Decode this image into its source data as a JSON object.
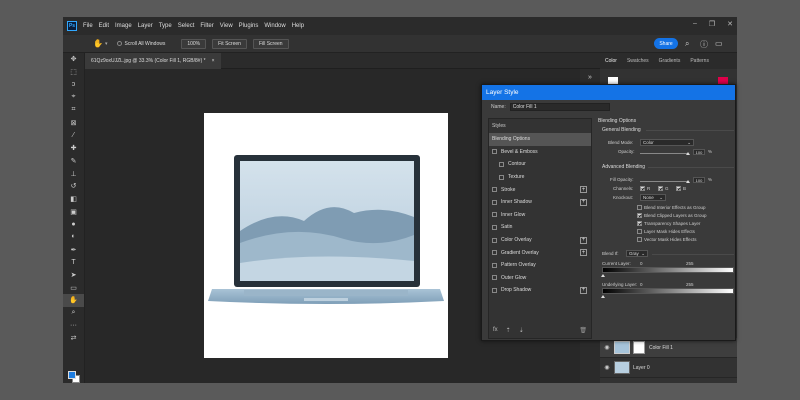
{
  "menubar": {
    "logo": "Ps",
    "items": [
      "File",
      "Edit",
      "Image",
      "Layer",
      "Type",
      "Select",
      "Filter",
      "View",
      "Plugins",
      "Window",
      "Help"
    ]
  },
  "options": {
    "scroll_all": "Scroll All Windows",
    "zoom100": "100%",
    "fit_screen": "Fit Screen",
    "fill_screen": "Fill Screen",
    "share": "Share"
  },
  "document": {
    "tab_title": "61Qz9oxUJZL.jpg @ 33.3% (Color Fill 1, RGB/8#) *",
    "close": "×"
  },
  "panel": {
    "tabs": [
      "Color",
      "Swatches",
      "Gradients",
      "Patterns"
    ],
    "fg_color": "#ffffff",
    "accent_color": "#e0004a"
  },
  "layers": [
    {
      "name": "Color Fill 1",
      "selected": true
    },
    {
      "name": "Layer 0",
      "selected": false
    }
  ],
  "dialog": {
    "title": "Layer Style",
    "name_label": "Name:",
    "name_value": "Color Fill 1",
    "styles_header": "Styles",
    "items": [
      {
        "label": "Blending Options",
        "check": false,
        "plus": false,
        "sub": false,
        "selected": true
      },
      {
        "label": "Bevel & Emboss",
        "check": true,
        "plus": false,
        "sub": false
      },
      {
        "label": "Contour",
        "check": true,
        "plus": false,
        "sub": true
      },
      {
        "label": "Texture",
        "check": true,
        "plus": false,
        "sub": true
      },
      {
        "label": "Stroke",
        "check": true,
        "plus": true,
        "sub": false
      },
      {
        "label": "Inner Shadow",
        "check": true,
        "plus": true,
        "sub": false
      },
      {
        "label": "Inner Glow",
        "check": true,
        "plus": false,
        "sub": false
      },
      {
        "label": "Satin",
        "check": true,
        "plus": false,
        "sub": false
      },
      {
        "label": "Color Overlay",
        "check": true,
        "plus": true,
        "sub": false
      },
      {
        "label": "Gradient Overlay",
        "check": true,
        "plus": true,
        "sub": false
      },
      {
        "label": "Pattern Overlay",
        "check": true,
        "plus": false,
        "sub": false
      },
      {
        "label": "Outer Glow",
        "check": true,
        "plus": false,
        "sub": false
      },
      {
        "label": "Drop Shadow",
        "check": true,
        "plus": true,
        "sub": false
      }
    ],
    "fx_label": "fx",
    "blending": {
      "section": "Blending Options",
      "general": "General Blending",
      "blend_mode_label": "Blend Mode:",
      "blend_mode_value": "Color",
      "opacity_label": "Opacity:",
      "opacity_value": "100",
      "pct": "%",
      "advanced": "Advanced Blending",
      "fill_opacity_label": "Fill Opacity:",
      "fill_opacity_value": "100",
      "channels_label": "Channels:",
      "channels": [
        "R",
        "G",
        "B"
      ],
      "knockout_label": "Knockout:",
      "knockout_value": "None",
      "options": [
        {
          "label": "Blend Interior Effects as Group",
          "checked": false
        },
        {
          "label": "Blend Clipped Layers as Group",
          "checked": true
        },
        {
          "label": "Transparency Shapes Layer",
          "checked": true
        },
        {
          "label": "Layer Mask Hides Effects",
          "checked": false
        },
        {
          "label": "Vector Mask Hides Effects",
          "checked": false
        }
      ],
      "blend_if_label": "Blend If:",
      "blend_if_value": "Gray",
      "current_layer_label": "Current Layer:",
      "current_layer_min": "0",
      "current_layer_max": "255",
      "underlying_label": "Underlying Layer:",
      "underlying_min": "0",
      "underlying_max": "255"
    }
  }
}
